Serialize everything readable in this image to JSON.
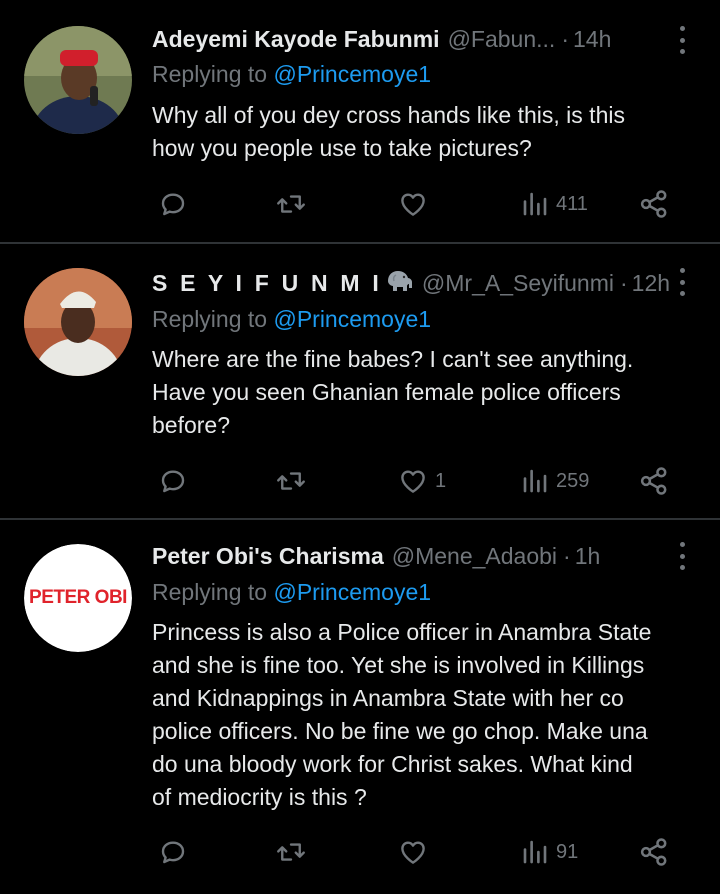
{
  "tweets": [
    {
      "name": "Adeyemi Kayode Fabunmi",
      "handle": "@Fabun...",
      "separator": "·",
      "time": "14h",
      "replying_prefix": "Replying to",
      "replying_to": "@Princemoye1",
      "text": "Why all of you dey cross hands like this, is this\nhow you people use to take pictures?",
      "likes": "",
      "views": "411",
      "avatar_icon": "profile-photo-red-cap"
    },
    {
      "name": "S E Y I F U N M I",
      "name_emoji": "elephant-icon",
      "handle": "@Mr_A_Seyifunmi",
      "separator": "·",
      "time": "12h",
      "replying_prefix": "Replying to",
      "replying_to": "@Princemoye1",
      "text": "Where are the fine babes? I can't see anything.\nHave you seen Ghanian female police officers\nbefore?",
      "likes": "1",
      "views": "259",
      "avatar_icon": "profile-photo-white-cap"
    },
    {
      "name": "Peter Obi's Charisma",
      "handle": "@Mene_Adaobi",
      "separator": "·",
      "time": "1h",
      "replying_prefix": "Replying to",
      "replying_to": "@Princemoye1",
      "text": "Princess is also a Police officer in Anambra State\nand she is fine too. Yet she is involved in Killings\nand Kidnappings in Anambra State with her co\npolice officers. No be fine we go chop. Make una\ndo una bloody work for Christ sakes. What kind\nof mediocrity is this ?",
      "likes": "",
      "views": "91",
      "avatar_logo_text": "PETER OBI"
    }
  ],
  "colors": {
    "background": "#000000",
    "text": "#e7e9ea",
    "muted": "#71767b",
    "link": "#1d9bf0",
    "divider": "#2f3336",
    "logo_red": "#e0232b"
  },
  "icons": [
    "reply-icon",
    "retweet-icon",
    "like-icon",
    "views-icon",
    "share-icon",
    "more-icon"
  ]
}
